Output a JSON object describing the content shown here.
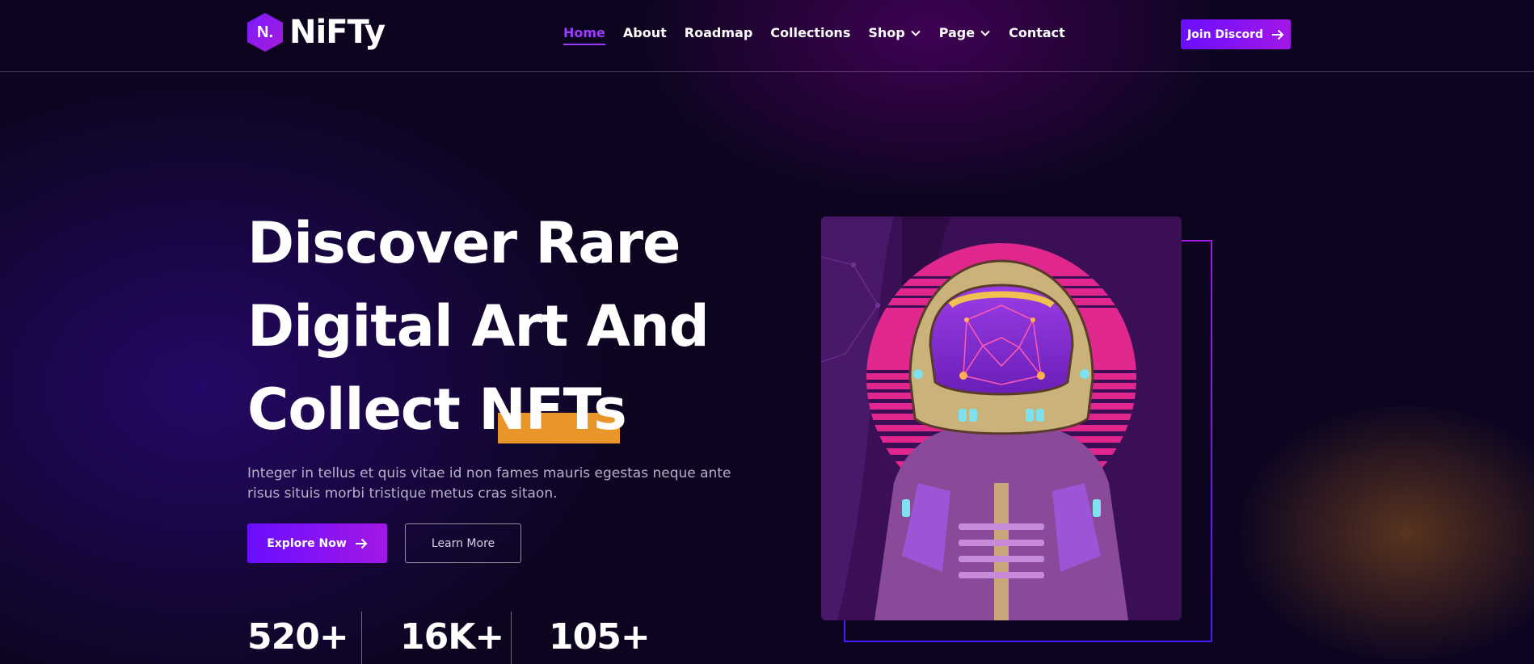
{
  "brand": {
    "logo_mark": "N.",
    "name": "NiFTy"
  },
  "nav": {
    "items": [
      {
        "label": "Home",
        "active": true
      },
      {
        "label": "About"
      },
      {
        "label": "Roadmap"
      },
      {
        "label": "Collections"
      },
      {
        "label": "Shop",
        "dropdown": true
      },
      {
        "label": "Page",
        "dropdown": true
      },
      {
        "label": "Contact"
      }
    ]
  },
  "header_cta": {
    "label": "Join Discord",
    "icon": "arrow-right-icon"
  },
  "hero": {
    "title_lines": [
      "Discover Rare",
      "Digital Art And",
      "Collect NFTs"
    ],
    "description": "Integer in tellus et quis vitae id non fames mauris egestas neque ante risus situis morbi tristique metus cras sitaon.",
    "primary_button": "Explore Now",
    "secondary_button": "Learn More"
  },
  "stats": [
    "520+",
    "16K+",
    "105+"
  ],
  "colors": {
    "accent": "#7a1bff",
    "accent_secondary": "#a218e6",
    "highlight": "#e8962a",
    "background": "#0d0520",
    "nav_active": "#9a3bff"
  },
  "art": {
    "description_icon": "astronaut-illustration"
  }
}
